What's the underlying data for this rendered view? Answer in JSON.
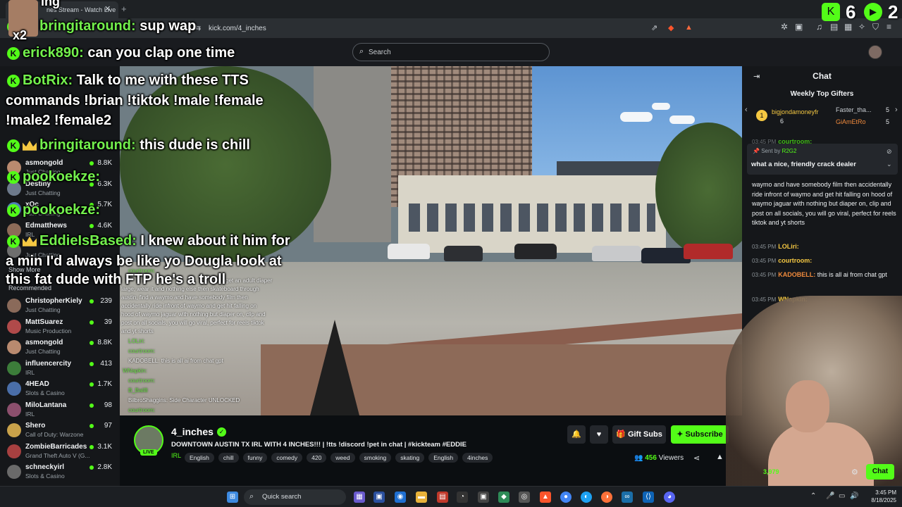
{
  "browser": {
    "tab_title": "nes Stream - Watch Live",
    "url": "kick.com/4_inches"
  },
  "top_overlay": {
    "stat_a": "6",
    "stat_b": "2",
    "multiplier": "x2",
    "partial_line": "ing"
  },
  "kickbar": {
    "search_placeholder": "Search"
  },
  "overlay_chat": [
    {
      "user": "bringitaround:",
      "text": "sup wap"
    },
    {
      "user": "erick890:",
      "text": "can you clap one time"
    },
    {
      "user": "BotRix:",
      "text": "Talk to me with these TTS"
    },
    {
      "user": "",
      "text": "commands !brian !tiktok !male !female"
    },
    {
      "user": "",
      "text": "!male2 !female2"
    },
    {
      "user": "bringitaround:",
      "text": "this dude is chill"
    },
    {
      "user": "pookoekze:",
      "text": ""
    },
    {
      "user": "pookoekze:",
      "text": ""
    },
    {
      "user": "EddieIsBased:",
      "text": "I knew about it him for"
    },
    {
      "user": "",
      "text": "a min I'd always be like yo Dougla look at"
    },
    {
      "user": "",
      "text": "this fat dude with FTP he's a troll"
    }
  ],
  "small_overlay_chat": [
    "courtroom:",
    "get an adult diaper",
    "large, wear it and nothing else then skateboard through",
    "austin, find a waymo and have somebody film then",
    "accidentally ride infront of waymo and get hit falling on",
    "hood of waymo jaguar with nothing but diaper on, clip and",
    "post on all socials, you will go viral, perfect for reels tiktok",
    "and yt shorts",
    "LOLiri:",
    "courtroom:",
    "KADOBELL: this is all ai from chat gpt",
    "WNapkin:",
    "courtroom:",
    "B_Bail8",
    "BilbroShaggins: Side Character UNLOCKED",
    "courtroom:"
  ],
  "sidebar": {
    "following": [
      {
        "name": "asmongold",
        "category": "Just Chatting",
        "count": "8.8K",
        "color": "#b98a6f"
      },
      {
        "name": "Destiny",
        "category": "Just Chatting",
        "count": "6.3K",
        "color": "#6d7a8c"
      },
      {
        "name": "xQc",
        "category": "Just Chatting",
        "count": "5.7K",
        "color": "#4f7fb5"
      },
      {
        "name": "Edmatthews",
        "category": "IRL",
        "count": "4.6K",
        "color": "#8d6b58"
      },
      {
        "name": "",
        "category": "Just Chatting",
        "count": "",
        "color": "#6e6e6e"
      }
    ],
    "show_more": "Show More",
    "recommended_label": "Recommended",
    "recommended": [
      {
        "name": "ChristopherKiely",
        "category": "Just Chatting",
        "count": "239",
        "color": "#8a6a5a"
      },
      {
        "name": "MattSuarez",
        "category": "Music Production",
        "count": "39",
        "color": "#b04a4a"
      },
      {
        "name": "asmongold",
        "category": "Just Chatting",
        "count": "8.8K",
        "color": "#b98a6f"
      },
      {
        "name": "influencercity",
        "category": "IRL",
        "count": "413",
        "color": "#3c7d3a"
      },
      {
        "name": "4HEAD",
        "category": "Slots & Casino",
        "count": "1.7K",
        "color": "#4a6ea8"
      },
      {
        "name": "MiloLantana",
        "category": "IRL",
        "count": "98",
        "color": "#8c4f6d"
      },
      {
        "name": "Shero",
        "category": "Call of Duty: Warzone",
        "count": "97",
        "color": "#c9a24a"
      },
      {
        "name": "ZombieBarricades",
        "category": "Grand Theft Auto V (G...",
        "count": "3.1K",
        "color": "#a74040"
      },
      {
        "name": "schneckyirl",
        "category": "Slots & Casino",
        "count": "2.8K",
        "color": "#6a6a6a"
      }
    ]
  },
  "stream": {
    "channel": "4_inches",
    "live": "LIVE",
    "title": "DOWNTOWN AUSTIN TX IRL WITH 4 INCHES!!! | !tts !discord !pet in chat | #kickteam #EDDIE",
    "category": "IRL",
    "tags": [
      "English",
      "chill",
      "funny",
      "comedy",
      "420",
      "weed",
      "smoking",
      "skating",
      "English",
      "4inches"
    ],
    "gift_subs": "Gift Subs",
    "subscribe": "Subscribe",
    "viewers": "456",
    "viewers_label": "Viewers"
  },
  "chat": {
    "title": "Chat",
    "weekly_gifters_title": "Weekly Top Gifters",
    "gifters": [
      {
        "name": "bigjondamoneyfr",
        "count": "6"
      },
      {
        "name": "Faster_tha...",
        "count": "5"
      },
      {
        "name": "GiAmEtRo",
        "count": "5"
      }
    ],
    "pinned_by_label": "Sent by",
    "pinned_by": "R2G2",
    "pinned_msg": "what a nice, friendly crack dealer",
    "messages": [
      {
        "time": "",
        "user": "",
        "text": "waymo and have somebody film then accidentally ride infront of waymo and get hit falling on hood of waymo jaguar with nothing but diaper on, clip and post on all socials, you will go viral, perfect for reels tiktok and yt shorts"
      },
      {
        "time": "03:45 PM",
        "user": "LOLiri:",
        "text": ""
      },
      {
        "time": "03:45 PM",
        "user": "courtroom:",
        "text": ""
      },
      {
        "time": "03:45 PM",
        "user": "KADOBELL:",
        "text": "this is all ai from chat gpt"
      },
      {
        "time": "03:45 PM",
        "user": "WNapkin:",
        "text": ""
      }
    ],
    "top_time": "03:45 PM",
    "top_user": "courtroom:",
    "user_count": "3,979",
    "chat_button": "Chat"
  },
  "taskbar": {
    "search": "Quick search",
    "time": "3:45 PM",
    "date": "8/18/2025"
  }
}
